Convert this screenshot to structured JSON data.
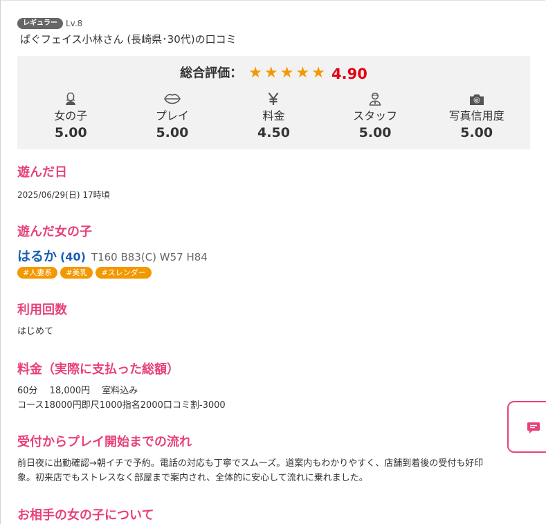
{
  "user": {
    "rank_badge": "レギュラー",
    "level": "Lv.8",
    "review_title": "ぱぐフェイス小林さん (長崎県･30代)の口コミ"
  },
  "rating": {
    "overall_label": "総合評価：",
    "overall_score": "4.90",
    "star_color": "#f39800",
    "score_color": "#e60012",
    "categories": [
      {
        "icon": "woman-icon",
        "label": "女の子",
        "score": "5.00"
      },
      {
        "icon": "lips-icon",
        "label": "プレイ",
        "score": "5.00"
      },
      {
        "icon": "yen-icon",
        "label": "料金",
        "score": "4.50"
      },
      {
        "icon": "staff-icon",
        "label": "スタッフ",
        "score": "5.00"
      },
      {
        "icon": "camera-icon",
        "label": "写真信用度",
        "score": "5.00"
      }
    ]
  },
  "visit_date": {
    "heading": "遊んだ日",
    "value": "2025/06/29(日) 17時頃"
  },
  "girl": {
    "heading": "遊んだ女の子",
    "name": "はるか",
    "age": "(40)",
    "size": "T160 B83(C) W57 H84",
    "tags": [
      "#人妻系",
      "#美乳",
      "#スレンダー"
    ]
  },
  "usage_count": {
    "heading": "利用回数",
    "value": "はじめて"
  },
  "price": {
    "heading": "料金（実際に支払った総額）",
    "line1": "60分　 18,000円　 室料込み",
    "line2": "コース18000円即尺1000指名2000口コミ割-3000"
  },
  "flow": {
    "heading": "受付からプレイ開始までの流れ",
    "line1": "前日夜に出勤確認→朝イチで予約。電話の対応も丁寧でスムーズ。道案内もわかりやすく、店舗到着後の受付も好印",
    "line2": "象。初来店でもストレスなく部屋まで案内され、全体的に安心して流れに乗れました。"
  },
  "about_girl": {
    "heading": "お相手の女の子について"
  },
  "theme": {
    "accent": "#e8407a",
    "link": "#1a5fb4",
    "tag": "#f39800"
  }
}
